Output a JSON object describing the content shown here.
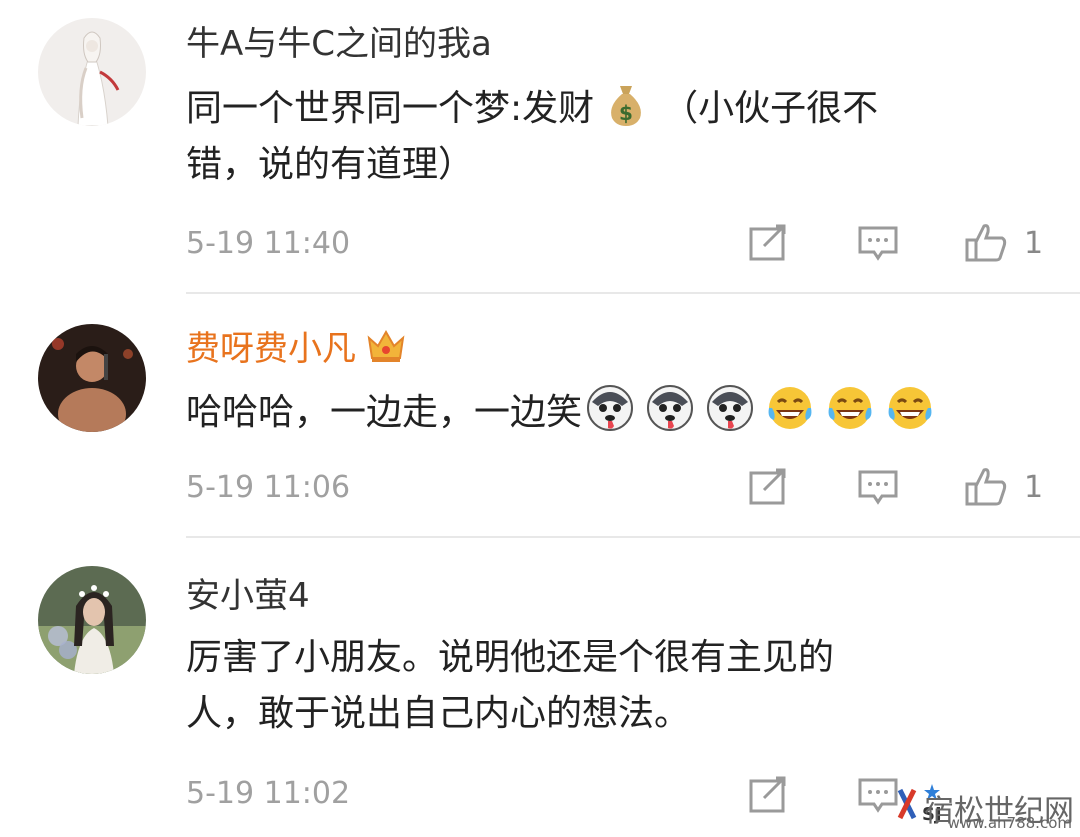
{
  "comments": [
    {
      "username": "牛A与牛C之间的我a",
      "text_lines": [
        "同一个世界同一个梦:发财",
        "（小伙子很不",
        "错，说的有道理）"
      ],
      "time": "5-19 11:40",
      "likes": "1"
    },
    {
      "username": "费呀费小凡",
      "text": "哈哈哈，一边走，一边笑",
      "time": "5-19 11:06",
      "likes": "1"
    },
    {
      "username": "安小萤4",
      "text_lines": [
        "厉害了小朋友。说明他还是个很有主见的",
        "人，敢于说出自己内心的想法。"
      ],
      "time": "5-19 11:02"
    }
  ],
  "colors": {
    "vip_name": "#e8731d",
    "normal_name": "#333333",
    "meta": "#a0a0a0",
    "divider": "#e8e8e8"
  },
  "watermark": {
    "text": "宿松世纪网",
    "url": "www.ah788.com"
  }
}
